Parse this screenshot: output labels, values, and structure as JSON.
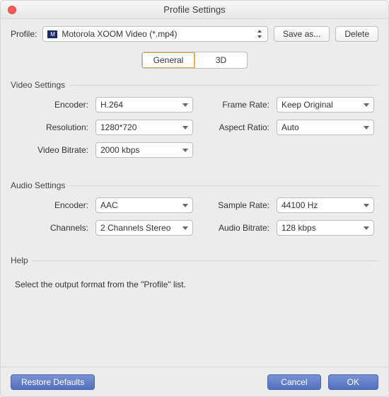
{
  "window": {
    "title": "Profile Settings"
  },
  "toprow": {
    "profile_label": "Profile:",
    "profile_value": "Motorola XOOM Video (*.mp4)",
    "saveas": "Save as...",
    "delete": "Delete"
  },
  "tabs": {
    "general": "General",
    "threeD": "3D"
  },
  "video": {
    "group": "Video Settings",
    "encoder_label": "Encoder:",
    "encoder": "H.264",
    "framerate_label": "Frame Rate:",
    "framerate": "Keep Original",
    "resolution_label": "Resolution:",
    "resolution": "1280*720",
    "aspect_label": "Aspect Ratio:",
    "aspect": "Auto",
    "bitrate_label": "Video Bitrate:",
    "bitrate": "2000 kbps"
  },
  "audio": {
    "group": "Audio Settings",
    "encoder_label": "Encoder:",
    "encoder": "AAC",
    "samplerate_label": "Sample Rate:",
    "samplerate": "44100 Hz",
    "channels_label": "Channels:",
    "channels": "2 Channels Stereo",
    "bitrate_label": "Audio Bitrate:",
    "bitrate": "128 kbps"
  },
  "help": {
    "group": "Help",
    "text": "Select the output format from the \"Profile\" list."
  },
  "footer": {
    "restore": "Restore Defaults",
    "cancel": "Cancel",
    "ok": "OK"
  }
}
